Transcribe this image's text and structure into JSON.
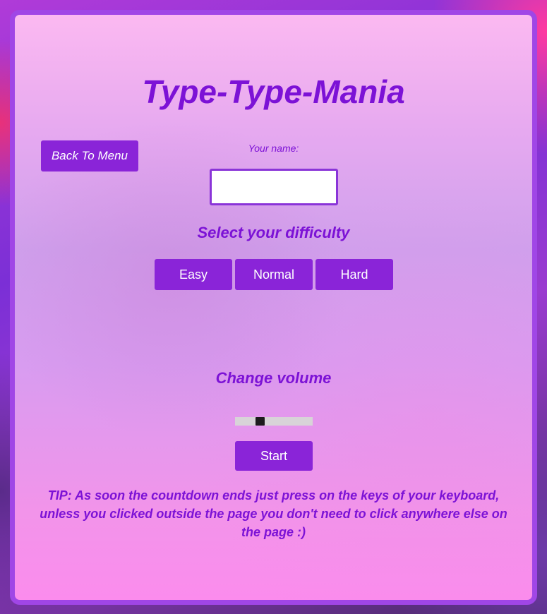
{
  "app": {
    "title": "Type-Type-Mania"
  },
  "nav": {
    "back_label": "Back To Menu"
  },
  "name_field": {
    "label": "Your name:",
    "value": "",
    "placeholder": ""
  },
  "difficulty": {
    "heading": "Select your difficulty",
    "options": [
      "Easy",
      "Normal",
      "Hard"
    ]
  },
  "volume": {
    "heading": "Change volume",
    "level": 0.3
  },
  "start": {
    "label": "Start"
  },
  "tip": {
    "text": "TIP: As soon the countdown ends just press on the keys of your keyboard, unless you clicked outside the page you don't need to click anywhere else on the page :)"
  },
  "colors": {
    "accent": "#8a24d8",
    "heading": "#7c12d6",
    "panel_border": "#a046e6"
  }
}
